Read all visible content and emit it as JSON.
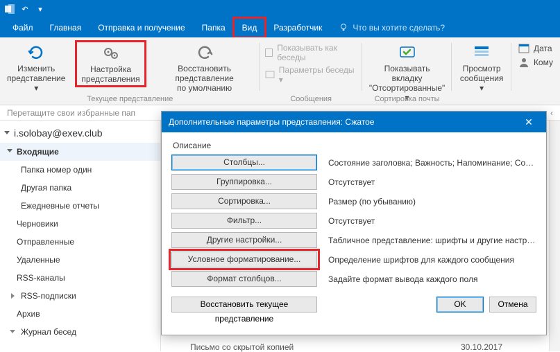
{
  "titlebar": {
    "app_icon": "outlook-icon",
    "qat_undo": "↶",
    "qat_menu": "▾"
  },
  "menu": {
    "file": "Файл",
    "home": "Главная",
    "sendrecv": "Отправка и получение",
    "folder": "Папка",
    "view": "Вид",
    "developer": "Разработчик",
    "tell_me": "Что вы хотите сделать?"
  },
  "ribbon": {
    "change_view_l1": "Изменить",
    "change_view_l2": "представление ▾",
    "view_settings_l1": "Настройка",
    "view_settings_l2": "представления",
    "reset_view_l1": "Восстановить представление",
    "reset_view_l2": "по умолчанию",
    "group1_label": "Текущее представление",
    "show_conv": "Показывать как беседы",
    "conv_settings": "Параметры беседы ▾",
    "group2_label": "Сообщения",
    "show_tab_l1": "Показывать вкладку",
    "show_tab_l2": "\"Отсортированные\" ▾",
    "group3_label": "Сортировка почты",
    "preview_l1": "Просмотр",
    "preview_l2": "сообщения ▾",
    "date_btn": "Дата",
    "to_btn": "Кому"
  },
  "favbar": {
    "text": "Перетащите свои избранные пап"
  },
  "sidebar": {
    "account": "i.solobay@exev.club",
    "items": [
      "Входящие",
      "Папка номер один",
      "Другая папка",
      "Ежедневные отчеты",
      "Черновики",
      "Отправленные",
      "Удаленные",
      "RSS-каналы",
      "RSS-подписки",
      "Архив",
      "Журнал бесед"
    ]
  },
  "dialog": {
    "title": "Дополнительные параметры представления: Сжатое",
    "fieldset": "Описание",
    "rows": [
      {
        "button": "Столбцы...",
        "desc": "Состояние заголовка; Важность; Напоминание; Состо..."
      },
      {
        "button": "Группировка...",
        "desc": "Отсутствует"
      },
      {
        "button": "Сортировка...",
        "desc": "Размер (по убыванию)"
      },
      {
        "button": "Фильтр...",
        "desc": "Отсутствует"
      },
      {
        "button": "Другие настройки...",
        "desc": "Табличное представление: шрифты и другие настрой..."
      },
      {
        "button": "Условное форматирование...",
        "desc": "Определение шрифтов для каждого сообщения"
      },
      {
        "button": "Формат столбцов...",
        "desc": "Задайте формат вывода каждого поля"
      }
    ],
    "restore": "Восстановить текущее представление",
    "ok": "OK",
    "cancel": "Отмена"
  },
  "msglist": {
    "subject": "Письмо со скрытой копией",
    "date": "30.10.2017"
  }
}
